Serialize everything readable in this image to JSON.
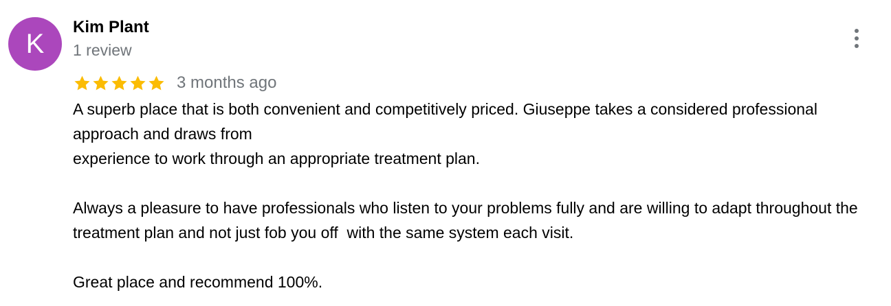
{
  "reviewer": {
    "initial": "K",
    "avatar_color": "#ab47bc",
    "name": "Kim Plant",
    "review_count": "1 review"
  },
  "rating": {
    "stars": 5,
    "max_stars": 5,
    "star_color": "#fbbc04",
    "date": "3 months ago"
  },
  "review": {
    "lines": [
      "A superb place that is both convenient and competitively priced. Giuseppe takes a considered professional approach and draws from",
      "experience to work through an appropriate treatment plan.",
      "",
      "Always a pleasure to have professionals who listen to your problems fully and are willing to adapt throughout the treatment plan and not just fob you off  with the same system each visit.",
      "",
      "Great place and recommend 100%."
    ]
  },
  "menu": {
    "icon": "more-vert-icon"
  }
}
